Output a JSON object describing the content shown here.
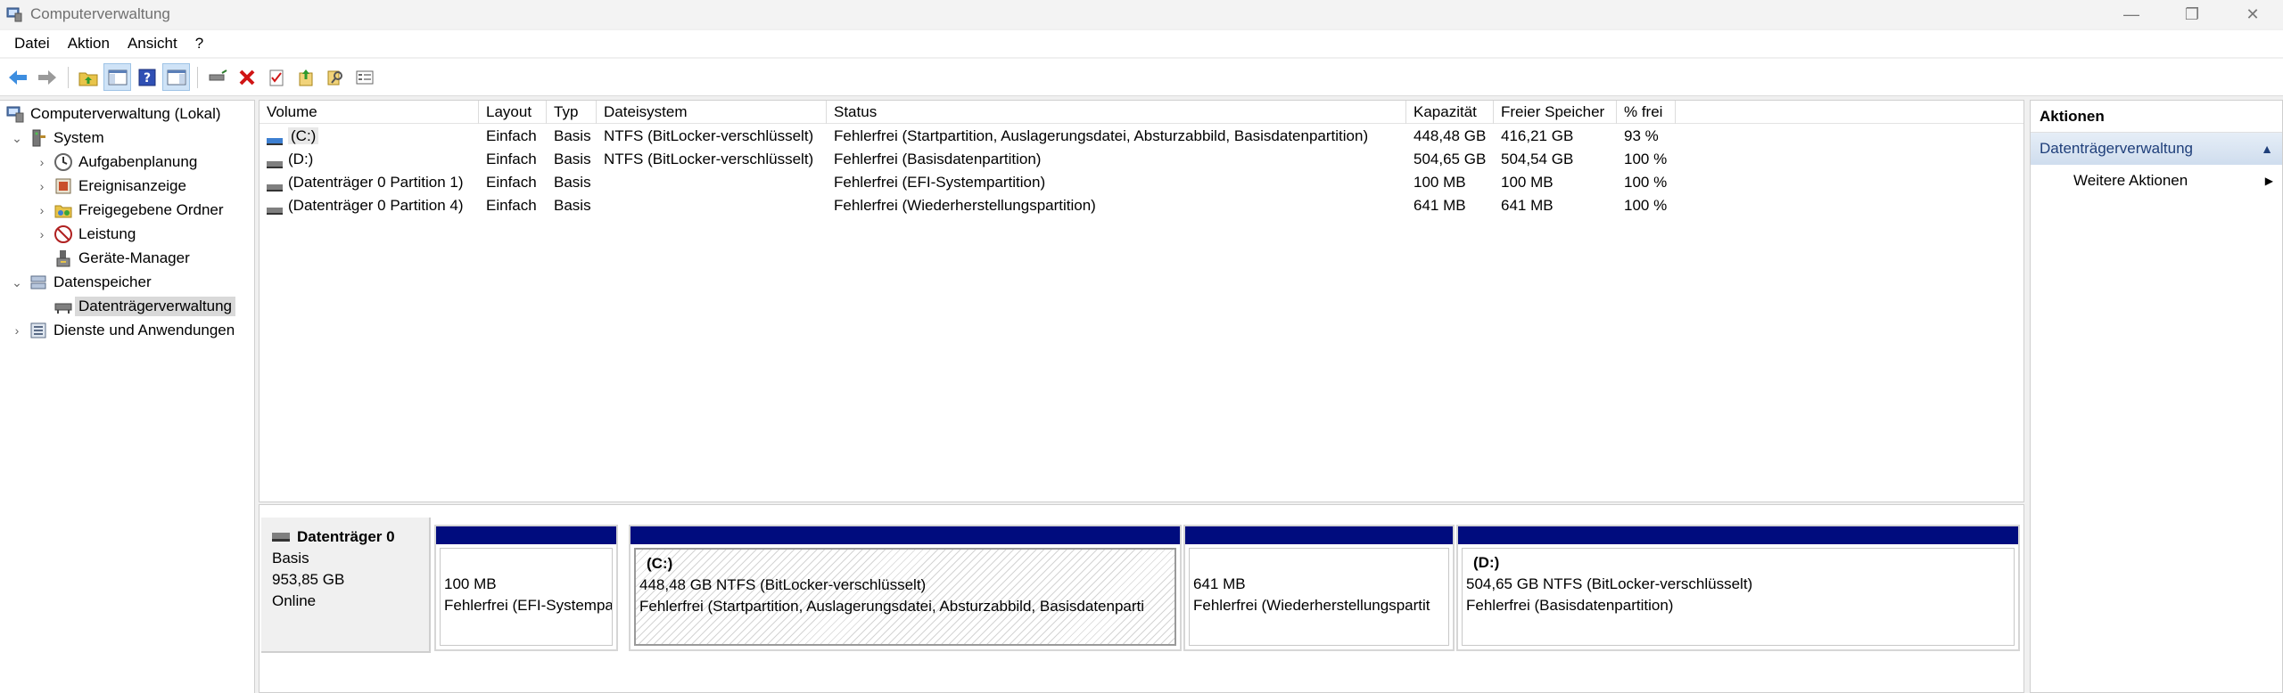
{
  "window": {
    "title": "Computerverwaltung",
    "controls": {
      "minimize": "—",
      "restore": "❐",
      "close": "✕"
    }
  },
  "menu": [
    "Datei",
    "Aktion",
    "Ansicht",
    "?"
  ],
  "toolbar": {
    "icons": [
      "back-icon",
      "forward-icon",
      "up-folder-icon",
      "show-hide-tree-icon",
      "help-icon",
      "show-action-pane-icon",
      "connect-drive-icon",
      "delete-icon",
      "properties-icon",
      "export-icon",
      "search-icon",
      "settings-icon"
    ]
  },
  "tree": {
    "root": "Computerverwaltung (Lokal)",
    "items": [
      {
        "label": "System",
        "level": 1,
        "expander": "⌄"
      },
      {
        "label": "Aufgabenplanung",
        "level": 2,
        "expander": "›"
      },
      {
        "label": "Ereignisanzeige",
        "level": 2,
        "expander": "›"
      },
      {
        "label": "Freigegebene Ordner",
        "level": 2,
        "expander": "›"
      },
      {
        "label": "Leistung",
        "level": 2,
        "expander": "›"
      },
      {
        "label": "Geräte-Manager",
        "level": 2,
        "expander": ""
      },
      {
        "label": "Datenspeicher",
        "level": 1,
        "expander": "⌄"
      },
      {
        "label": "Datenträgerverwaltung",
        "level": 2,
        "expander": "",
        "selected": true
      },
      {
        "label": "Dienste und Anwendungen",
        "level": 1,
        "expander": "›"
      }
    ]
  },
  "volumes": {
    "columns": [
      "Volume",
      "Layout",
      "Typ",
      "Dateisystem",
      "Status",
      "Kapazität",
      "Freier Speicher",
      "% frei"
    ],
    "rows": [
      [
        "(C:)",
        "Einfach",
        "Basis",
        "NTFS (BitLocker-verschlüsselt)",
        "Fehlerfrei (Startpartition, Auslagerungsdatei, Absturzabbild, Basisdatenpartition)",
        "448,48 GB",
        "416,21 GB",
        "93 %"
      ],
      [
        "(D:)",
        "Einfach",
        "Basis",
        "NTFS (BitLocker-verschlüsselt)",
        "Fehlerfrei (Basisdatenpartition)",
        "504,65 GB",
        "504,54 GB",
        "100 %"
      ],
      [
        "(Datenträger 0 Partition 1)",
        "Einfach",
        "Basis",
        "",
        "Fehlerfrei (EFI-Systempartition)",
        "100 MB",
        "100 MB",
        "100 %"
      ],
      [
        "(Datenträger 0 Partition 4)",
        "Einfach",
        "Basis",
        "",
        "Fehlerfrei (Wiederherstellungspartition)",
        "641 MB",
        "641 MB",
        "100 %"
      ]
    ]
  },
  "disk": {
    "name": "Datenträger 0",
    "type": "Basis",
    "size": "953,85 GB",
    "status": "Online",
    "partitions": [
      {
        "name": "",
        "size": "100 MB",
        "status": "Fehlerfrei (EFI-Systempa"
      },
      {
        "name": "(C:)",
        "size": "448,48 GB NTFS (BitLocker-verschlüsselt)",
        "status": "Fehlerfrei (Startpartition, Auslagerungsdatei, Absturzabbild, Basisdatenparti"
      },
      {
        "name": "",
        "size": "641 MB",
        "status": "Fehlerfrei (Wiederherstellungspartit"
      },
      {
        "name": "(D:)",
        "size": "504,65 GB NTFS (BitLocker-verschlüsselt)",
        "status": "Fehlerfrei (Basisdatenpartition)"
      }
    ]
  },
  "actions": {
    "header": "Aktionen",
    "section": "Datenträgerverwaltung",
    "section_arrow": "▲",
    "more": "Weitere Aktionen",
    "more_arrow": "▶"
  },
  "colors": {
    "partition_bar": "#000c7e",
    "selection": "#cfe3f7",
    "action_section_text": "#1f3f7a"
  }
}
